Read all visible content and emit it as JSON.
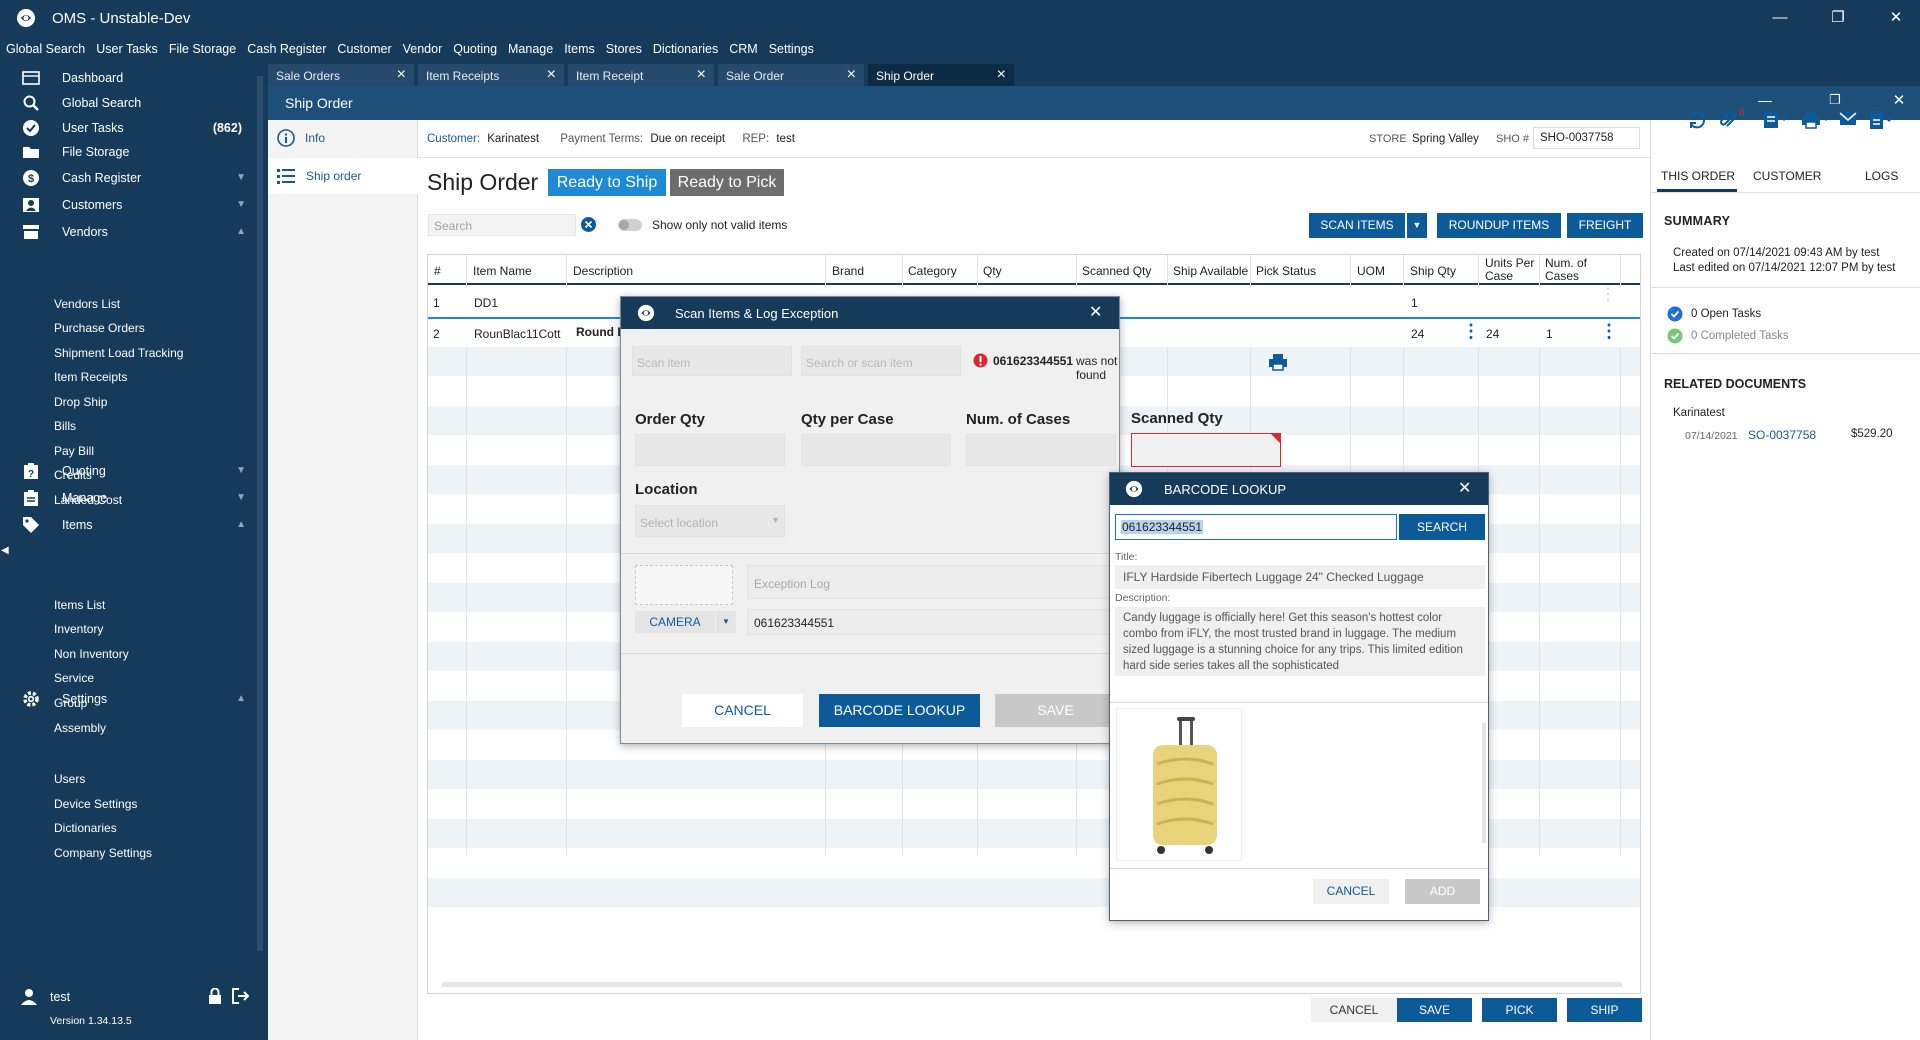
{
  "app": {
    "title": "OMS - Unstable-Dev"
  },
  "menu": [
    "Global Search",
    "User Tasks",
    "File Storage",
    "Cash Register",
    "Customer",
    "Vendor",
    "Quoting",
    "Manage",
    "Items",
    "Stores",
    "Dictionaries",
    "CRM",
    "Settings"
  ],
  "sidebar": {
    "items": [
      {
        "label": "Dashboard",
        "icon": "dashboard-icon"
      },
      {
        "label": "Global Search",
        "icon": "search-icon"
      },
      {
        "label": "User Tasks",
        "icon": "check-circle-icon",
        "count": "(862)"
      },
      {
        "label": "File Storage",
        "icon": "folder-icon"
      },
      {
        "label": "Cash Register",
        "icon": "dollar-icon"
      },
      {
        "label": "Customers",
        "icon": "user-card-icon"
      },
      {
        "label": "Vendors",
        "icon": "store-icon"
      },
      {
        "label": "Quoting",
        "icon": "quote-icon"
      },
      {
        "label": "Manage",
        "icon": "clipboard-icon"
      },
      {
        "label": "Items",
        "icon": "tag-icon"
      },
      {
        "label": "Settings",
        "icon": "gear-icon"
      }
    ],
    "vendors_sub": [
      "Vendors List",
      "Purchase Orders",
      "Shipment Load Tracking",
      "Item Receipts",
      "Drop Ship",
      "Bills",
      "Pay Bill",
      "Credits",
      "Landed Cost"
    ],
    "items_sub": [
      "Items List",
      "Inventory",
      "Non Inventory",
      "Service",
      "Group",
      "Assembly"
    ],
    "settings_sub": [
      "Users",
      "Device Settings",
      "Dictionaries",
      "Company Settings"
    ],
    "user": "test",
    "version": "Version 1.34.13.5"
  },
  "tabs": [
    "Sale Orders",
    "Item Receipts",
    "Item Receipt",
    "Sale Order",
    "Ship Order"
  ],
  "window": {
    "title": "Ship Order"
  },
  "leftnav": [
    "Info",
    "Ship order"
  ],
  "order": {
    "customer_label": "Customer:",
    "customer": "Karinatest",
    "terms_label": "Payment Terms:",
    "terms": "Due on receipt",
    "rep_label": "REP:",
    "rep": "test",
    "store_label": "STORE",
    "store": "Spring Valley",
    "sho_label": "SHO #",
    "sho": "SHO-0037758",
    "heading": "Ship Order",
    "badge_ready_ship": "Ready to Ship",
    "badge_ready_pick": "Ready to Pick",
    "search_placeholder": "Search",
    "toggle_label": "Show only not valid items",
    "btn_scan": "SCAN ITEMS",
    "btn_roundup": "ROUNDUP ITEMS",
    "btn_freight": "FREIGHT"
  },
  "table": {
    "headers": [
      "#",
      "Item Name",
      "Description",
      "Brand",
      "Category",
      "Qty",
      "Scanned Qty",
      "Ship Available",
      "Pick Status",
      "UOM",
      "Ship Qty",
      "Units Per Case",
      "Num. of Cases"
    ],
    "rows": [
      {
        "num": "1",
        "name": "DD1",
        "desc": "",
        "ship_qty": "1",
        "units": "",
        "cases": ""
      },
      {
        "num": "2",
        "name": "RounBlac11Cott",
        "desc": "Round B",
        "ship_qty": "24",
        "units": "24",
        "cases": "1"
      }
    ]
  },
  "footer": {
    "cancel": "CANCEL",
    "save": "SAVE",
    "pick": "PICK",
    "ship": "SHIP"
  },
  "right": {
    "tabs": [
      "THIS ORDER",
      "CUSTOMER",
      "LOGS"
    ],
    "summary_title": "SUMMARY",
    "created": "Created on 07/14/2021 09:43 AM by test",
    "edited": "Last edited on 07/14/2021 12:07 PM by test",
    "open_tasks": "0 Open Tasks",
    "completed_tasks": "0 Completed Tasks",
    "related_title": "RELATED DOCUMENTS",
    "related_customer": "Karinatest",
    "related_date": "07/14/2021",
    "related_doc": "SO-0037758",
    "related_amount": "$529.20",
    "attach_count": "0"
  },
  "scan_modal": {
    "title": "Scan Items & Log Exception",
    "scan_placeholder": "Scan item",
    "search_placeholder": "Search or scan item",
    "error_code": "061623344551",
    "error_text": "was not found",
    "order_qty": "Order Qty",
    "qty_per_case": "Qty per Case",
    "num_cases": "Num. of Cases",
    "scanned_qty": "Scanned Qty",
    "location": "Location",
    "location_placeholder": "Select location",
    "exception_placeholder": "Exception Log",
    "camera": "CAMERA",
    "barcode_value": "061623344551",
    "cancel": "CANCEL",
    "lookup": "BARCODE LOOKUP",
    "save": "SAVE"
  },
  "barcode_modal": {
    "title": "BARCODE LOOKUP",
    "query": "061623344551",
    "search": "SEARCH",
    "title_label": "Title:",
    "product_title": "IFLY Hardside Fibertech Luggage 24\" Checked Luggage",
    "desc_label": "Description:",
    "description": "Candy luggage is officially here! Get this season's hottest color combo from iFLY, the most trusted brand in luggage. The medium sized luggage is a stunning choice for any trips. This limited edition hard side series takes all the sophisticated",
    "cancel": "CANCEL",
    "add": "ADD"
  },
  "colors": {
    "navy": "#163a59",
    "accent": "#0d5a99",
    "badge_blue": "#1e8ad6",
    "badge_gray": "#6d6d6d",
    "error": "#d9282f"
  }
}
